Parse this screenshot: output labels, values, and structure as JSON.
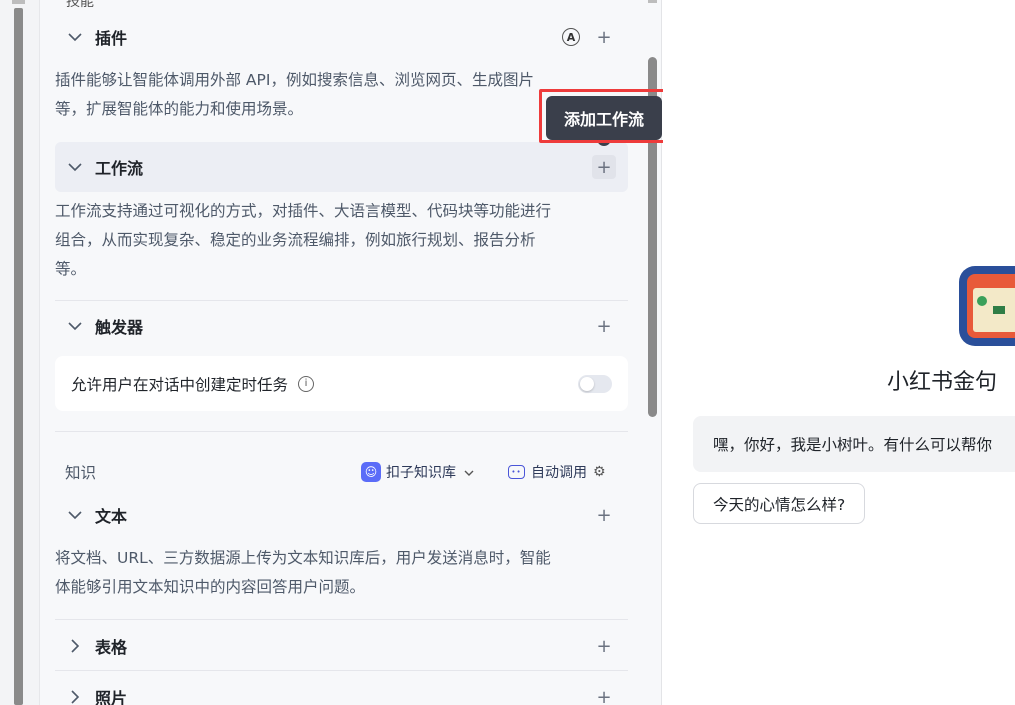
{
  "sections": {
    "cut_heading": "技能",
    "plugins": {
      "title": "插件",
      "auto_icon": "A",
      "add": "+",
      "desc_line1": "插件能够让智能体调用外部 API，例如搜索信息、浏览网页、生成图片",
      "desc_line2": "等，扩展智能体的能力和使用场景。"
    },
    "workflow": {
      "title": "工作流",
      "add": "+",
      "desc_line1": "工作流支持通过可视化的方式，对插件、大语言模型、代码块等功能进行",
      "desc_line2": "组合，从而实现复杂、稳定的业务流程编排，例如旅行规划、报告分析",
      "desc_line3": "等。"
    },
    "trigger": {
      "title": "触发器",
      "add": "+",
      "option_label": "允许用户在对话中创建定时任务",
      "toggle_on": false
    },
    "knowledge": {
      "title": "知识",
      "source_label": "扣子知识库",
      "auto_label": "自动调用"
    },
    "text": {
      "title": "文本",
      "add": "+",
      "desc_line1": "将文档、URL、三方数据源上传为文本知识库后，用户发送消息时，智能",
      "desc_line2": "体能够引用文本知识中的内容回答用户问题。"
    },
    "table": {
      "title": "表格",
      "add": "+"
    },
    "photo": {
      "title": "照片",
      "add": "+"
    }
  },
  "tooltip": {
    "text": "添加工作流"
  },
  "preview": {
    "bot_name": "小红书金句",
    "greeting": "嘿，你好，我是小树叶。有什么可以帮你",
    "suggestion": "今天的心情怎么样?"
  },
  "colors": {
    "highlight_border": "#ee3b3b",
    "tooltip_bg": "#3a3f4b",
    "accent": "#5b6cf8"
  }
}
